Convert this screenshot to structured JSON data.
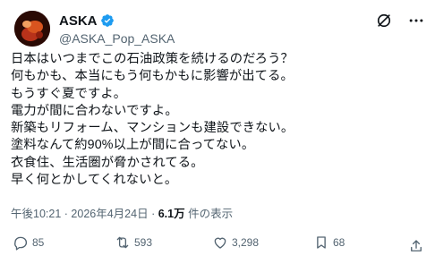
{
  "author": {
    "name": "ASKA",
    "handle": "@ASKA_Pop_ASKA"
  },
  "tweet": {
    "lines": [
      "日本はいつまでこの石油政策を続けるのだろう？",
      "何もかも、本当にもう何もかもに影響が出てる。",
      "もうすぐ夏ですよ。",
      "電力が間に合わないですよ。",
      "新築もリフォーム、マンションも建設できない。",
      "塗料なんて約90%以上が間に合ってない。",
      "衣食住、生活圏が脅かされてる。",
      "早く何とかしてくれないと。"
    ],
    "time": "午後10:21",
    "separator": "·",
    "date": "2026年4月24日",
    "views_count": "6.1万",
    "views_label": "件の表示"
  },
  "actions": {
    "replies": "85",
    "reposts": "593",
    "likes": "3,298",
    "bookmarks": "68"
  },
  "colors": {
    "text": "#0f1419",
    "muted": "#536471",
    "verified": "#1d9bf0"
  }
}
